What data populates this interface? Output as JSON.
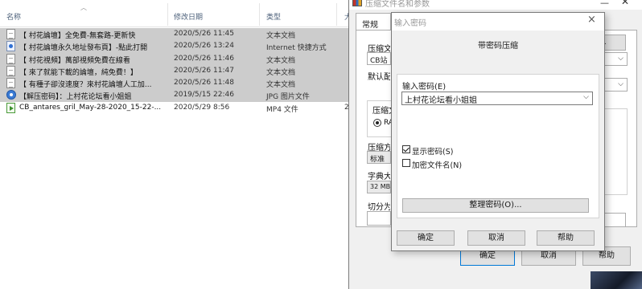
{
  "explorer": {
    "columns": {
      "name": "名称",
      "date": "修改日期",
      "type": "类型",
      "size": "大"
    },
    "files": [
      {
        "icon": "text-file-icon",
        "name": "【 村花論壇】全免費-無套路-更新快",
        "date": "2020/5/26 11:45",
        "type": "文本文档",
        "size": "",
        "selected": true
      },
      {
        "icon": "internet-shortcut-icon",
        "name": "【 村花論壇永久地址發布頁】-點此打開",
        "date": "2020/5/26 13:24",
        "type": "Internet 快捷方式",
        "size": "",
        "selected": true
      },
      {
        "icon": "text-file-icon",
        "name": "【 村花視頻】萬部視頻免費在線看",
        "date": "2020/5/26 11:46",
        "type": "文本文档",
        "size": "",
        "selected": true
      },
      {
        "icon": "text-file-icon",
        "name": "【 來了就能下載的論壇，純免費！】",
        "date": "2020/5/26 11:47",
        "type": "文本文档",
        "size": "",
        "selected": true
      },
      {
        "icon": "text-file-icon",
        "name": "【 有種子卻沒速度？來村花論壇人工加...",
        "date": "2020/5/26 11:48",
        "type": "文本文档",
        "size": "",
        "selected": true
      },
      {
        "icon": "jpg-image-icon",
        "name": "【解压密码】：上村花论坛看小姐姐",
        "date": "2019/5/15 22:46",
        "type": "JPG 图片文件",
        "size": "",
        "selected": true
      },
      {
        "icon": "mp4-video-icon",
        "name": "CB_antares_gril_May-28-2020_15-22-...",
        "date": "2020/5/29 8:56",
        "type": "MP4 文件",
        "size": "2,",
        "selected": false
      }
    ]
  },
  "archive_dialog": {
    "title": "压缩文件名和参数",
    "tab_general": "常规",
    "label_archive_name": "压缩文",
    "archive_name_value": "CB站 a",
    "browse_button": "(B)...",
    "label_profile": "默认配",
    "label_format": "压缩文",
    "radio_format": "RA",
    "label_method": "压缩方",
    "method_value": "标准",
    "label_dict": "字典大",
    "dict_value": "32 MB",
    "label_split": "切分为",
    "ok": "确定",
    "cancel": "取消",
    "help": "帮助"
  },
  "password_dialog": {
    "title": "输入密码",
    "close": "×",
    "heading": "带密码压缩",
    "password_label": "输入密码(E)",
    "password_value": "上村花论坛看小姐姐",
    "show_password_label": "显示密码(S)",
    "show_password_checked": true,
    "encrypt_names_label": "加密文件名(N)",
    "encrypt_names_checked": false,
    "organize_button": "整理密码(O)...",
    "ok": "确定",
    "cancel": "取消",
    "help": "帮助"
  }
}
